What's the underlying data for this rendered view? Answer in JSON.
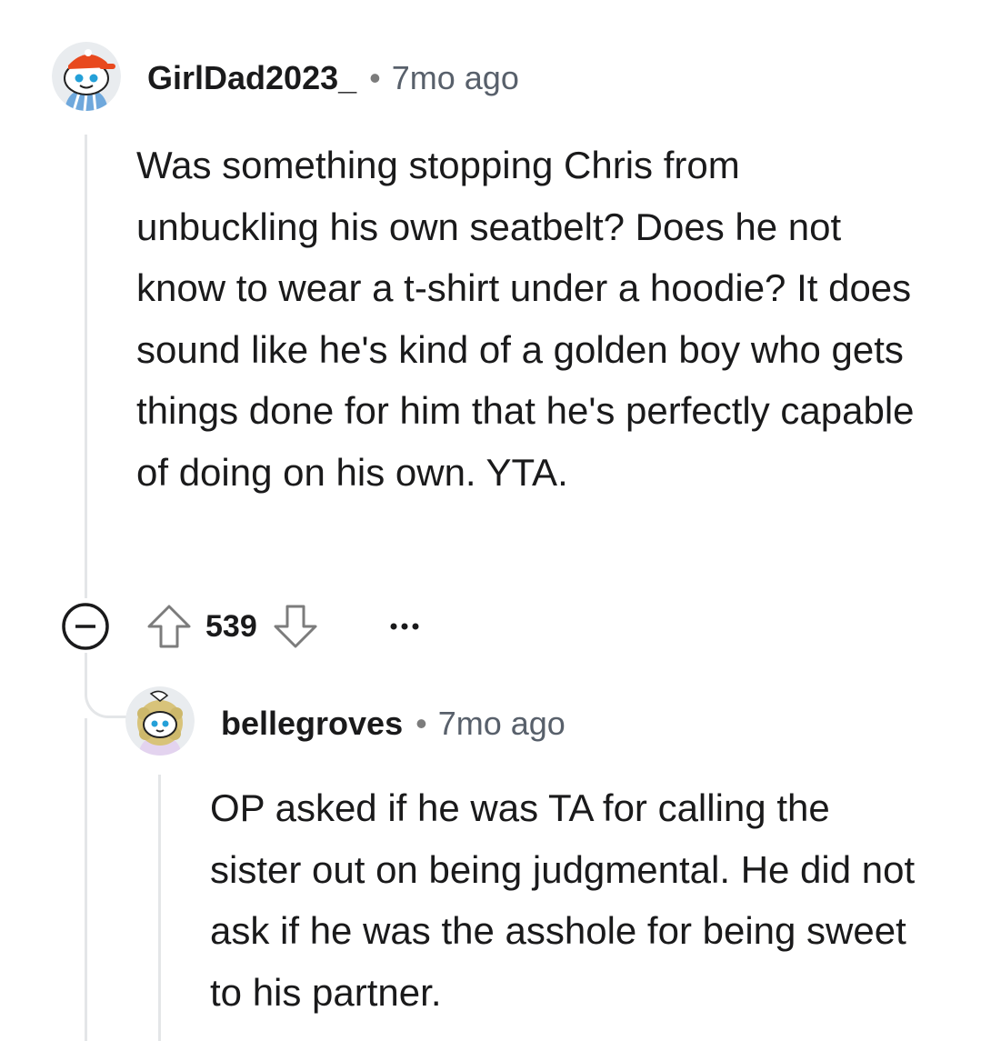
{
  "comment": {
    "username": "GirlDad2023_",
    "separator": "•",
    "timestamp": "7mo ago",
    "body": "Was something stopping Chris from unbuckling his own seatbelt? Does he not know to wear a t-shirt under a hoodie? It does sound like he's kind of a golden boy who gets things done for him that he's perfectly capable of doing on his own. YTA.",
    "score": "539",
    "avatar_icon": "snoo-avatar-icon",
    "reply": {
      "username": "bellegroves",
      "separator": "•",
      "timestamp": "7mo ago",
      "body": "OP asked if he was TA for calling the sister out on being judgmental. He did not ask if he was the asshole for being sweet to his partner.",
      "avatar_icon": "snoo-avatar-icon"
    }
  },
  "colors": {
    "thread_line": "#e4e6e8",
    "meta_gray": "#58606b",
    "text": "#1a1a1b",
    "icon": "#7c7c7c"
  }
}
